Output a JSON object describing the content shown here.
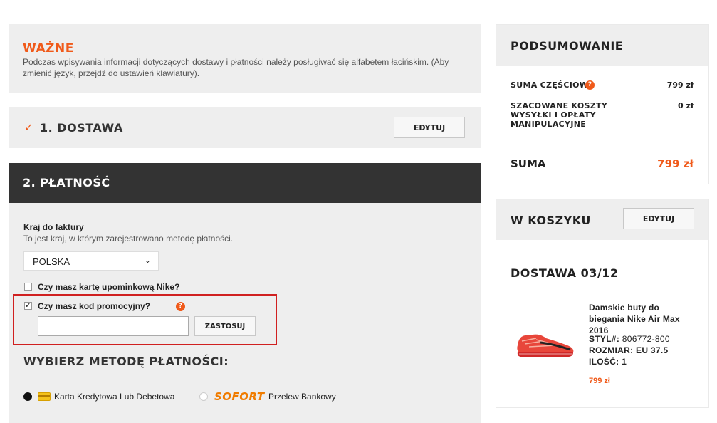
{
  "notice": {
    "title": "WAŻNE",
    "text": "Podczas wpisywania informacji dotyczących dostawy i płatności należy posługiwać się alfabetem łacińskim. (Aby zmienić język, przejdź do ustawień klawiatury)."
  },
  "delivery": {
    "title": "1. DOSTAWA",
    "edit_label": "EDYTUJ"
  },
  "payment": {
    "title": "2. PŁATNOŚĆ",
    "country_label": "Kraj do faktury",
    "country_help": "To jest kraj, w którym zarejestrowano metodę płatności.",
    "country_value": "POLSKA",
    "gift_card_label": "Czy masz kartę upominkową Nike?",
    "gift_card_checked": false,
    "promo_label": "Czy masz kod promocyjny?",
    "promo_checked": true,
    "promo_value": "",
    "promo_apply": "ZASTOSUJ",
    "method_title": "WYBIERZ METODĘ PŁATNOŚCI:",
    "methods": [
      {
        "label": "Karta Kredytowa Lub Debetowa",
        "selected": true,
        "icon": "credit-card-icon"
      },
      {
        "label": "Przelew Bankowy",
        "selected": false,
        "logo_text": "SOFORT"
      }
    ]
  },
  "summary": {
    "title": "PODSUMOWANIE",
    "subtotal_label": "SUMA CZĘŚCIOWA",
    "subtotal_value": "799 zł",
    "shipping_label": "SZACOWANE KOSZTY WYSYŁKI I OPŁATY MANIPULACYJNE",
    "shipping_value": "0 zł",
    "total_label": "SUMA",
    "total_value": "799 zł"
  },
  "cart": {
    "title": "W KOSZYKU",
    "edit_label": "EDYTUJ",
    "delivery_date": "DOSTAWA 03/12",
    "product": {
      "name": "Damskie buty do biegania Nike Air Max 2016",
      "style_label": "STYL#:",
      "style_value": "806772-800",
      "size_label": "ROZMIAR:",
      "size_value": "EU 37.5",
      "qty_label": "ILOŚĆ:",
      "qty_value": "1",
      "price": "799 zł"
    }
  },
  "colors": {
    "accent": "#f05a1a",
    "dark_header": "#333333",
    "panel_bg": "#eeeeee",
    "highlight_border": "#d02020"
  }
}
